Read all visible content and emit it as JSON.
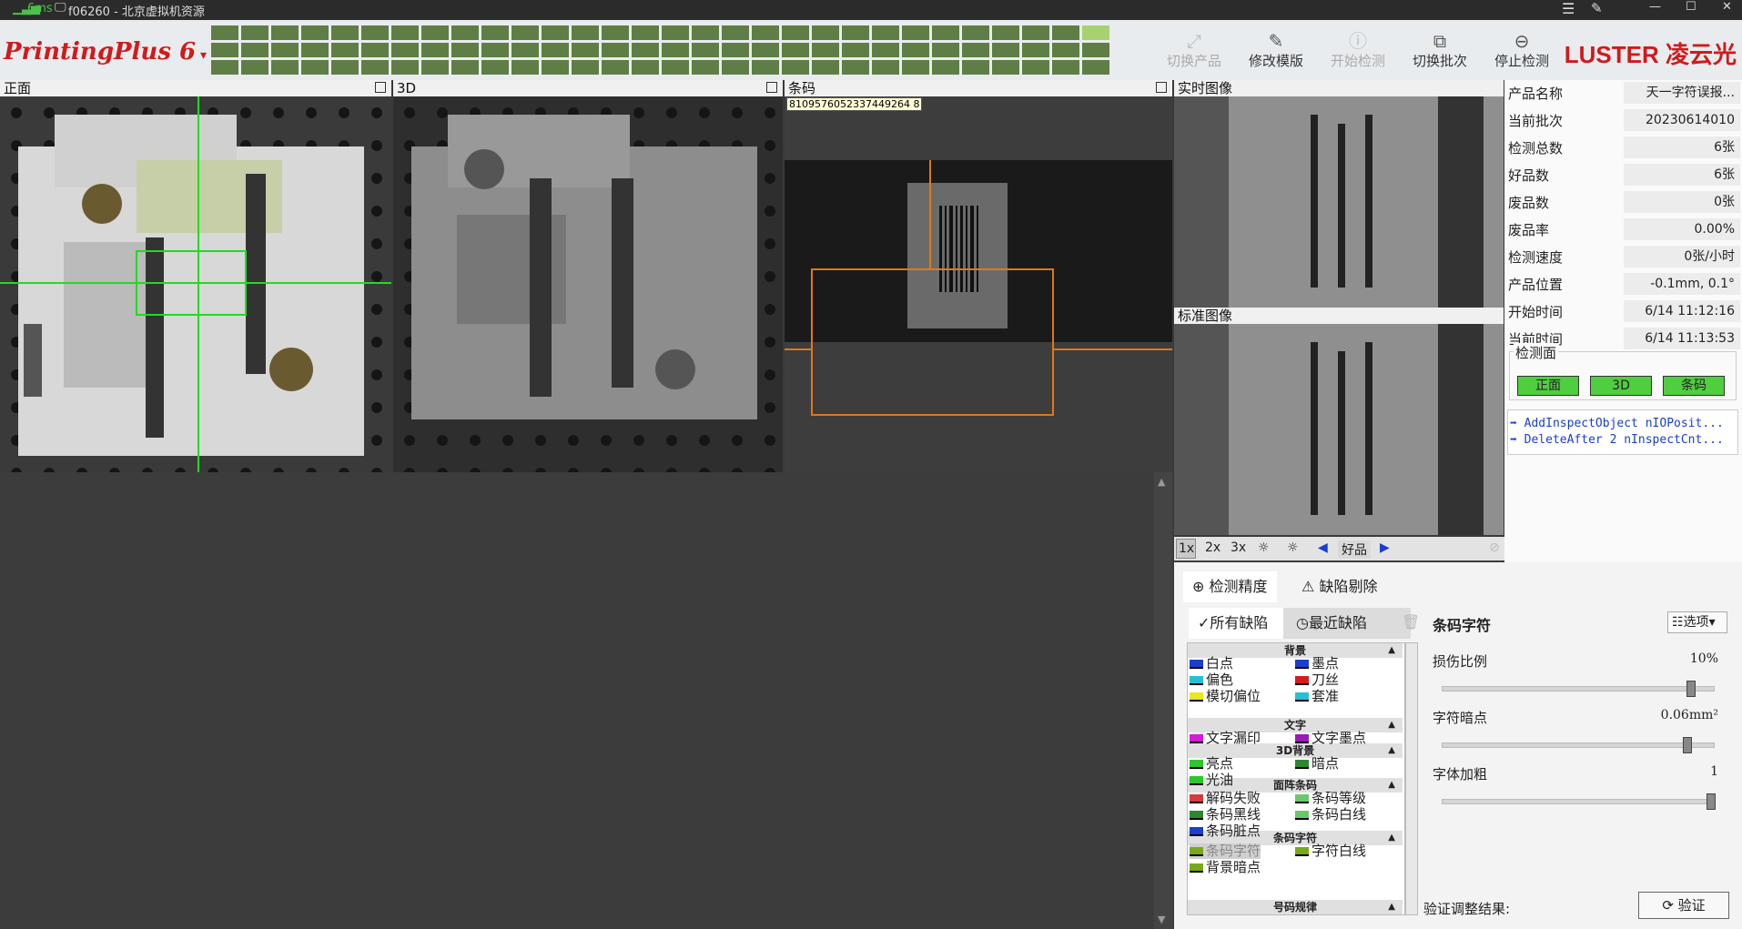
{
  "titlebar": {
    "signal": "6ms",
    "machine": "f06260 - 北京虚拟机资源"
  },
  "app": {
    "name": "PrintingPlus 6",
    "brand": "LUSTER 凌云光"
  },
  "toolbar": {
    "switch_product": "切换产品",
    "modify_template": "修改模版",
    "start_inspect": "开始检测",
    "switch_batch": "切换批次",
    "stop_inspect": "停止检测"
  },
  "views": {
    "front": "正面",
    "three_d": "3D",
    "barcode": "条码",
    "barcode_value": "8109576052337449264 8",
    "live": "实时图像",
    "standard": "标准图像"
  },
  "info": [
    {
      "k": "产品名称",
      "v": "天一字符误报..."
    },
    {
      "k": "当前批次",
      "v": "20230614010"
    },
    {
      "k": "检测总数",
      "v": "6张"
    },
    {
      "k": "好品数",
      "v": "6张"
    },
    {
      "k": "废品数",
      "v": "0张"
    },
    {
      "k": "废品率",
      "v": "0.00%"
    },
    {
      "k": "检测速度",
      "v": "0张/小时"
    },
    {
      "k": "产品位置",
      "v": "-0.1mm,  0.1°"
    },
    {
      "k": "开始时间",
      "v": "6/14 11:12:16"
    },
    {
      "k": "当前时间",
      "v": "6/14 11:13:53"
    }
  ],
  "inspect_face": {
    "title": "检测面",
    "buttons": [
      "正面",
      "3D",
      "条码"
    ]
  },
  "log": [
    "AddInspectObject nIOPosit...",
    "DeleteAfter 2 nInspectCnt..."
  ],
  "zoom": {
    "z1": "1x",
    "z2": "2x",
    "z3": "3x",
    "status": "好品"
  },
  "tabs": {
    "precision": "检测精度",
    "defect_remove": "缺陷剔除"
  },
  "subtabs": {
    "all": "所有缺陷",
    "recent": "最近缺陷"
  },
  "legend": {
    "cat_bg": "背景",
    "cat_text": "文字",
    "cat_3d": "3D背景",
    "cat_barcode": "面阵条码",
    "cat_barchar": "条码字符",
    "cat_serial": "号码规律",
    "items": [
      "白点",
      "墨点",
      "偏色",
      "刀丝",
      "模切偏位",
      "套准",
      "文字漏印",
      "文字墨点",
      "亮点",
      "暗点",
      "光油",
      "解码失败",
      "条码等级",
      "条码黑线",
      "条码白线",
      "条码脏点",
      "条码字符",
      "字符白线",
      "背景暗点"
    ]
  },
  "detail": {
    "title": "条码字符",
    "options": "选项",
    "s1": "损伤比例",
    "v1": "10%",
    "s2": "字符暗点",
    "v2": "0.06mm²",
    "s3": "字体加粗",
    "v3": "1",
    "verify_label": "验证调整结果:",
    "verify_btn": "验证"
  },
  "colors": {
    "accent": "#d11a1a",
    "green_ok": "#4fce3f",
    "grid": "#5f7e46"
  }
}
